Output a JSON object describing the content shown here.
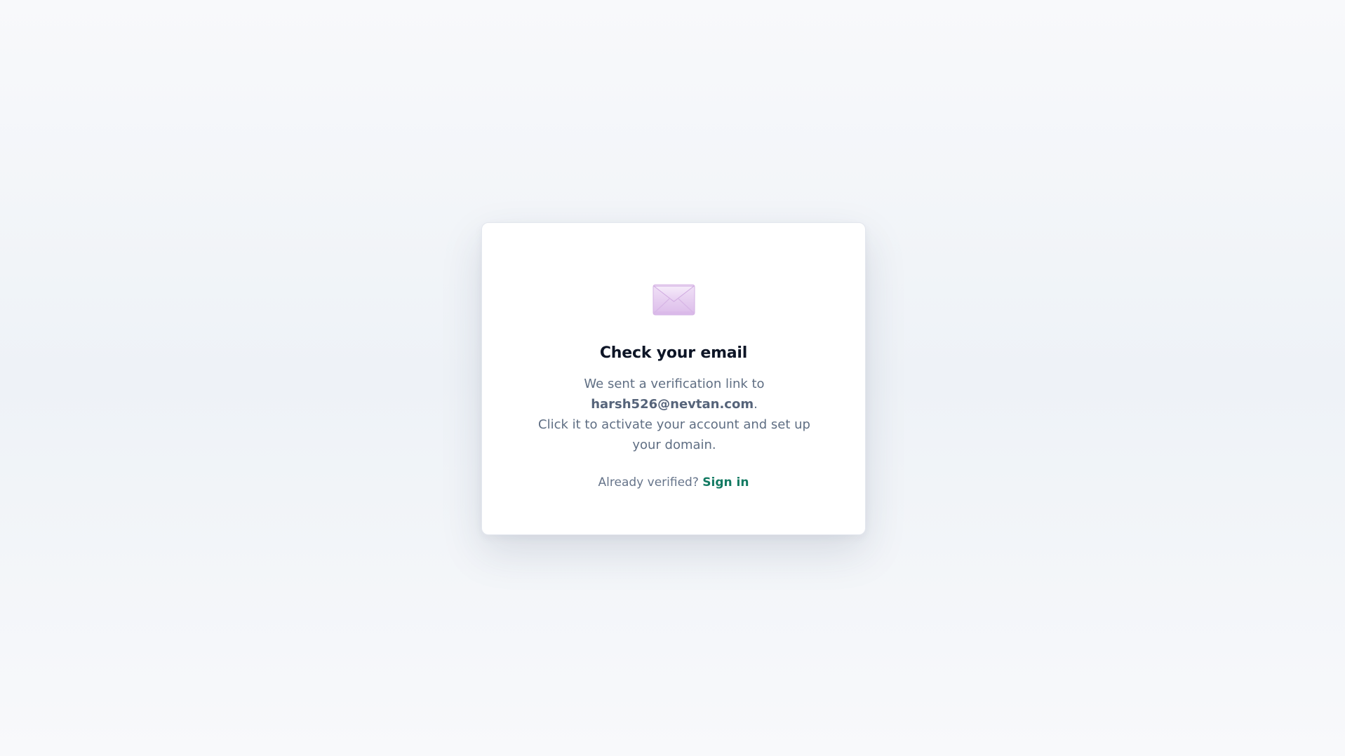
{
  "card": {
    "icon": "envelope-icon",
    "title": "Check your email",
    "message_prefix": "We sent a verification link to",
    "email": "harsh526@nevtan.com",
    "message_period": ".",
    "message_line2": "Click it to activate your account and set up your domain.",
    "footer_text": "Already verified?",
    "signin_label": "Sign in"
  },
  "colors": {
    "background": "#f3f5f9",
    "card": "#ffffff",
    "title": "#0d1526",
    "body_text": "#5f6e83",
    "link": "#137a62",
    "envelope": "#e9d2f3"
  }
}
